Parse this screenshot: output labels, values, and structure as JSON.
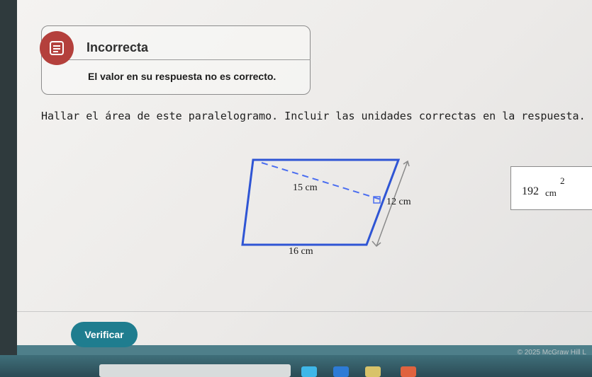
{
  "feedback": {
    "status": "Incorrecta",
    "message": "El valor en su respuesta no es correcto."
  },
  "question": {
    "text": "Hallar el área de este paralelogramo. Incluir las unidades correctas en la respuesta."
  },
  "figure": {
    "slant_side_label": "15 cm",
    "height_label": "12 cm",
    "base_label": "16 cm"
  },
  "answer": {
    "value": "192",
    "unit": "cm",
    "exponent": "2"
  },
  "actions": {
    "verify_label": "Verificar"
  },
  "footer": {
    "copyright": "© 2025 McGraw Hill L"
  },
  "icons": {
    "status": "incorrect-feedback-icon"
  },
  "colors": {
    "status_icon": "#b4403c",
    "figure_outline": "#2f55d4",
    "verify_button": "#1f7d8f"
  }
}
